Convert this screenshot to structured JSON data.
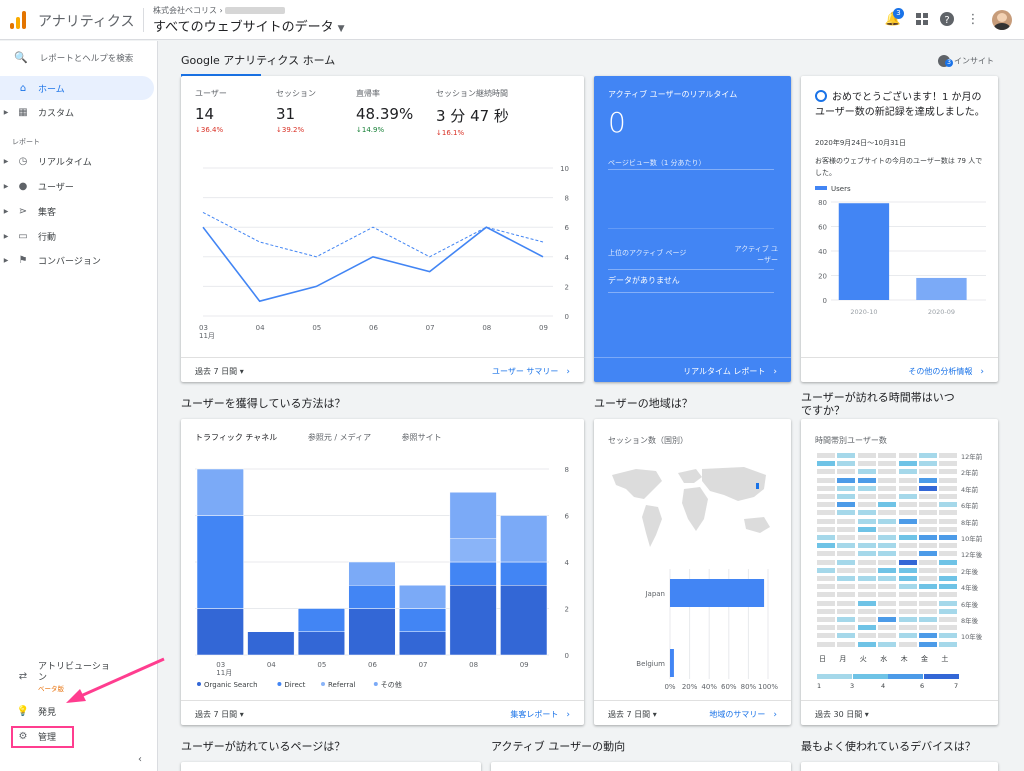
{
  "topbar": {
    "app_name": "アナリティクス",
    "account_name": "株式会社ベコリス",
    "view_title": "すべてのウェブサイトのデータ",
    "notification_count": "3"
  },
  "sidebar": {
    "search_placeholder": "レポートとヘルプを検索",
    "home": "ホーム",
    "custom": "カスタム",
    "reports_label": "レポート",
    "reports": [
      "リアルタイム",
      "ユーザー",
      "集客",
      "行動",
      "コンバージョン"
    ],
    "attribution": "アトリビューション",
    "beta": "ベータ版",
    "discover": "発見",
    "admin": "管理"
  },
  "page": {
    "title": "Google アナリティクス ホーム",
    "insight": "インサイト"
  },
  "overview": {
    "metrics": [
      {
        "label": "ユーザー",
        "value": "14",
        "delta": "↓36.4%",
        "trend": "down"
      },
      {
        "label": "セッション",
        "value": "31",
        "delta": "↓39.2%",
        "trend": "down"
      },
      {
        "label": "直帰率",
        "value": "48.39%",
        "delta": "↓14.9%",
        "trend": "good"
      },
      {
        "label": "セッション継続時間",
        "value": "3 分 47 秒",
        "delta": "↓16.1%",
        "trend": "down"
      }
    ],
    "range": "過去 7 日間",
    "link": "ユーザー サマリー"
  },
  "chart_data": [
    {
      "type": "line",
      "x": [
        "03\n11月",
        "04",
        "05",
        "06",
        "07",
        "08",
        "09"
      ],
      "series": [
        {
          "values": [
            6,
            1,
            2,
            4,
            3,
            6,
            4
          ],
          "style": "solid"
        },
        {
          "values": [
            7,
            5,
            4,
            6,
            4,
            6,
            5
          ],
          "style": "dashed"
        }
      ],
      "ylim": [
        0,
        10
      ],
      "yticks": [
        "10",
        "8",
        "6",
        "4",
        "2",
        "0"
      ],
      "grid": true
    },
    {
      "type": "bar",
      "title": "Users",
      "categories": [
        "2020-10",
        "2020-09"
      ],
      "values": [
        79,
        18
      ],
      "ylim": [
        0,
        80
      ],
      "yticks": [
        "80",
        "60",
        "40",
        "20",
        "0"
      ]
    },
    {
      "type": "bar",
      "stacked": true,
      "categories": [
        "03\n11月",
        "04",
        "05",
        "06",
        "07",
        "08",
        "09"
      ],
      "series": [
        {
          "name": "Organic Search",
          "values": [
            2,
            1,
            1,
            2,
            1,
            3,
            3
          ]
        },
        {
          "name": "Direct",
          "values": [
            4,
            0,
            1,
            1,
            1,
            1,
            1
          ]
        },
        {
          "name": "Referral",
          "values": [
            0,
            0,
            0,
            0,
            0,
            1,
            0
          ]
        },
        {
          "name": "その他",
          "values": [
            2,
            0,
            0,
            1,
            1,
            2,
            2
          ]
        }
      ],
      "ylim": [
        0,
        8
      ],
      "yticks": [
        "8",
        "6",
        "4",
        "2",
        "0"
      ]
    },
    {
      "type": "bar",
      "orientation": "horizontal",
      "title": "セッション数（国別）",
      "categories": [
        "Japan",
        "Belgium"
      ],
      "values": [
        96,
        4
      ],
      "xticks": [
        "0%",
        "20%",
        "40%",
        "60%",
        "80%",
        "100%"
      ]
    }
  ],
  "realtime": {
    "title": "アクティブ ユーザーのリアルタイム",
    "value": "0",
    "pageviews_label": "ページビュー数（1 分あたり）",
    "top_pages": "上位のアクティブ ページ",
    "active_users": "アクティブ ユーザー",
    "no_data": "データがありません",
    "link": "リアルタイム レポート"
  },
  "insight_card": {
    "headline": "おめでとうございます！1 か月のユーザー数の新記録を達成しました。",
    "date_range": "2020年9月24日〜10月31日",
    "body": "お客様のウェブサイトの今月のユーザー数は 79 人でした。",
    "link": "その他の分析情報"
  },
  "acquisition": {
    "title": "ユーザーを獲得している方法は？",
    "tabs": [
      "トラフィック チャネル",
      "参照元 / メディア",
      "参照サイト"
    ],
    "range": "過去 7 日間",
    "link": "集客レポート"
  },
  "geo": {
    "title": "ユーザーの地域は？",
    "range": "過去 7 日間",
    "link": "地域のサマリー"
  },
  "time_of_day": {
    "title": "ユーザーが訪れる時間帯はいつですか？",
    "subtitle": "時間帯別ユーザー数",
    "hours": [
      "12年前",
      "2年前",
      "4年前",
      "6年前",
      "8年前",
      "10年前",
      "12年後",
      "2年後",
      "4年後",
      "6年後",
      "8年後",
      "10年後"
    ],
    "days": [
      "日",
      "月",
      "火",
      "水",
      "木",
      "金",
      "土"
    ],
    "scale": [
      "1",
      "3",
      "4",
      "6",
      "7"
    ],
    "range": "過去 30 日間"
  },
  "bottom": {
    "pages_title": "ユーザーが訪れているページは？",
    "active_title": "アクティブ ユーザーの動向",
    "device_title": "最もよく使われているデバイスは？"
  },
  "colors": {
    "accent": "#1a73e8",
    "realtime_bg": "#4285f4",
    "highlight": "#ff3d8f"
  }
}
